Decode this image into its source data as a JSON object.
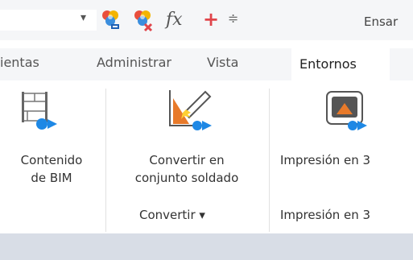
{
  "qat": {
    "dropdown_arrow": "▾",
    "customize_icon": "≑",
    "fx_label": "fx",
    "title": "Ensar"
  },
  "tabs": [
    {
      "label": "ientas"
    },
    {
      "label": "Administrar"
    },
    {
      "label": "Vista"
    },
    {
      "label": "Entornos",
      "active": true
    }
  ],
  "ribbon": {
    "buttons": [
      {
        "label_line1": "Contenido",
        "label_line2": "de BIM",
        "icon": "bim-content-icon"
      },
      {
        "label_line1": "Convertir en",
        "label_line2": "conjunto soldado",
        "icon": "convert-weldment-icon"
      },
      {
        "label_line1": "Impresión en 3",
        "icon": "3d-print-icon"
      }
    ],
    "panels": [
      {
        "label": "Convertir ▾"
      },
      {
        "label": "Impresión en 3"
      }
    ]
  },
  "colors": {
    "accent_blue": "#1e88e5",
    "plus_red": "#e0454b",
    "tab_bar": "#f5f6f8",
    "status_bar": "#d8dde6"
  }
}
